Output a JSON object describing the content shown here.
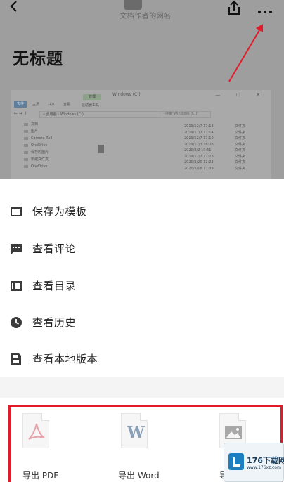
{
  "header": {
    "doc_owner": "文档作者的网名",
    "doc_title": "无标题"
  },
  "explorer": {
    "window_title": "Windows (C:)",
    "win_buttons": "— ☐ ✕",
    "ribbon": {
      "file": "文件",
      "tabs": [
        "主页",
        "共享",
        "查看"
      ],
      "manage": "管理",
      "drive_tools": "驱动器工具"
    },
    "address": "« 此电脑 › Windows (C:)",
    "search_placeholder": "搜索\"Windows (C:)\"",
    "sidebar": [
      "文档",
      "图片",
      "Camera Roll",
      "OneDrive",
      "保存的图片",
      "新建文件夹",
      "OneDrive"
    ],
    "dates": [
      "2019/12/7 17:18",
      "2019/12/7 17:14",
      "2019/12/7 17:10",
      "2019/12/3 16:03",
      "2020/3/2 19:51",
      "2019/12/7 17:23",
      "2020/3/20 12:23",
      "2020/5/18 17:39"
    ],
    "types": [
      "文件夹",
      "文件夹",
      "文件夹",
      "文件夹",
      "文件夹",
      "文件夹",
      "文件夹",
      "文件夹"
    ]
  },
  "menu": {
    "items": [
      {
        "label": "保存为模板",
        "icon": "template-icon"
      },
      {
        "label": "查看评论",
        "icon": "comment-icon"
      },
      {
        "label": "查看目录",
        "icon": "toc-icon"
      },
      {
        "label": "查看历史",
        "icon": "history-icon"
      },
      {
        "label": "查看本地版本",
        "icon": "save-local-icon"
      }
    ]
  },
  "export": {
    "items": [
      {
        "label": "导出 PDF",
        "icon": "pdf-file-icon"
      },
      {
        "label": "导出 Word",
        "icon": "word-file-icon"
      },
      {
        "label": "导出",
        "icon": "image-file-icon"
      }
    ]
  },
  "watermark": {
    "text": "176下载网",
    "sub": "www.176xz.com"
  },
  "colors": {
    "accent_red": "#e21a2a",
    "icon_dark": "#3a3a3a",
    "dim_overlay": "#9e9e9e"
  }
}
